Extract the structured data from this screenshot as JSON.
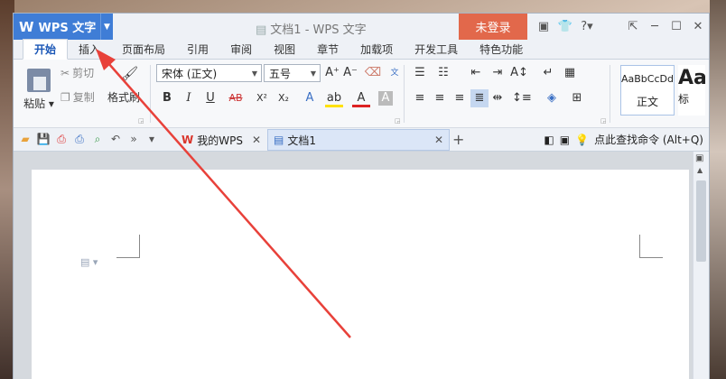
{
  "app": {
    "title": "WPS 文字",
    "doc_title": "文档1 - WPS 文字",
    "login": "未登录"
  },
  "ribbon_tabs": [
    "开始",
    "插入",
    "页面布局",
    "引用",
    "审阅",
    "视图",
    "章节",
    "加载项",
    "开发工具",
    "特色功能"
  ],
  "clipboard": {
    "paste": "粘贴",
    "cut": "剪切",
    "copy": "复制",
    "format_painter": "格式刷"
  },
  "font": {
    "name": "宋体 (正文)",
    "size": "五号"
  },
  "styles": [
    {
      "sample": "AaBbCcDd",
      "name": "正文"
    },
    {
      "sample": "Aa",
      "name": "标"
    }
  ],
  "doc_tabs": [
    {
      "label": "我的WPS"
    },
    {
      "label": "文档1"
    }
  ],
  "search_command": "点此查找命令 (Alt+Q)",
  "colors": {
    "brand": "#3f7dd6",
    "login": "#e2684b",
    "annotation_arrow": "#e8413a"
  }
}
